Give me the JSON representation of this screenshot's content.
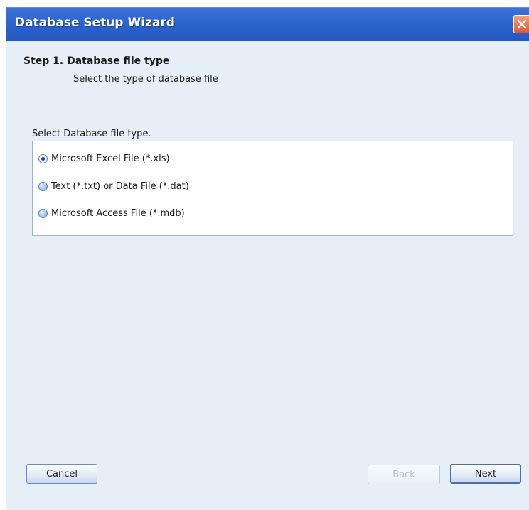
{
  "window": {
    "title": "Database Setup Wizard"
  },
  "step": {
    "title": "Step 1. Database file type",
    "subtitle": "Select the type of database file"
  },
  "selection": {
    "label": "Select Database file type.",
    "options": [
      {
        "label": "Microsoft Excel File (*.xls)",
        "checked": true
      },
      {
        "label": "Text (*.txt) or Data File (*.dat)",
        "checked": false
      },
      {
        "label": "Microsoft Access File (*.mdb)",
        "checked": false
      }
    ]
  },
  "buttons": {
    "cancel": "Cancel",
    "back": "Back",
    "next": "Next",
    "back_enabled": false
  },
  "colors": {
    "title_bar": "#2d64cf",
    "background": "#e6eef8",
    "close": "#e0582f"
  },
  "icons": {
    "close": "close-icon"
  }
}
